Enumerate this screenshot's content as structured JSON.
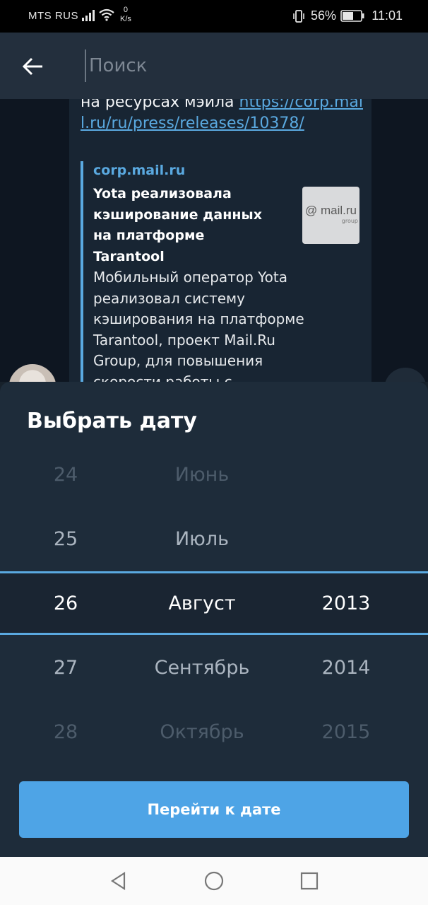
{
  "status_bar": {
    "carrier": "MTS RUS",
    "net_speed_value": "0",
    "net_speed_unit": "K/s",
    "battery_percent": "56%",
    "time": "11:01"
  },
  "toolbar": {
    "search_placeholder": "Поиск"
  },
  "message": {
    "text_before_link": "на ресурсах мэйла ",
    "link": "https://corp.mail.ru/ru/press/releases/10378/",
    "preview": {
      "site": "corp.mail.ru",
      "title": "Yota реализовала кэширование данных на платформе Tarantool",
      "description": "Мобильный оператор Yota реализовал систему кэширования на платформе Tarantool, проект Mail.Ru Group, для повышения скорости работы с",
      "thumb_logo": "@ mail.ru",
      "thumb_sub": "group"
    }
  },
  "date_picker": {
    "title": "Выбрать дату",
    "rows": [
      {
        "day": "24",
        "month": "Июнь",
        "year": ""
      },
      {
        "day": "25",
        "month": "Июль",
        "year": ""
      },
      {
        "day": "26",
        "month": "Август",
        "year": "2013"
      },
      {
        "day": "27",
        "month": "Сентябрь",
        "year": "2014"
      },
      {
        "day": "28",
        "month": "Октябрь",
        "year": "2015"
      }
    ],
    "selected_index": 2,
    "button_label": "Перейти к дате"
  },
  "colors": {
    "accent": "#5aa9e0",
    "button": "#4ea4e6",
    "sheet_bg": "#1e2c3a"
  },
  "icons": {
    "back": "arrow-left-icon",
    "nav_back": "triangle-back-icon",
    "nav_home": "circle-home-icon",
    "nav_recents": "square-recents-icon"
  }
}
